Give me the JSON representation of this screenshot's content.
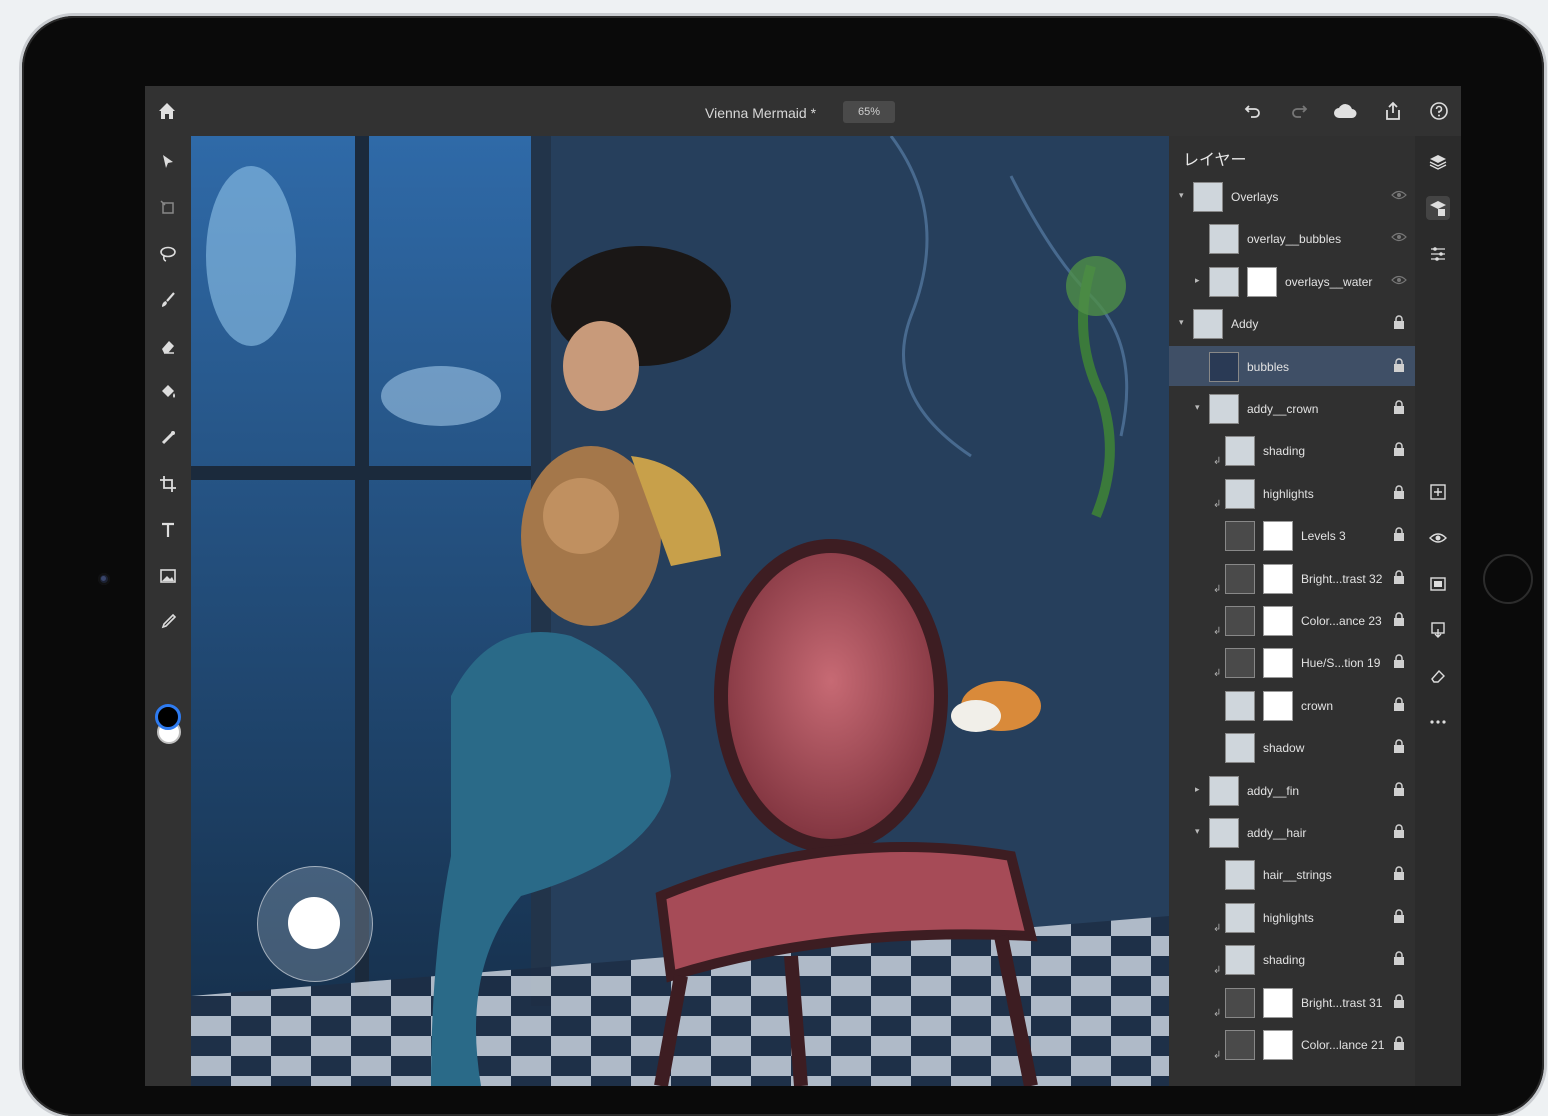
{
  "app": {
    "document_title": "Vienna Mermaid *",
    "zoom": "65%"
  },
  "topbar": {
    "icons": [
      "home-icon",
      "undo-icon",
      "redo-icon",
      "cloud-icon",
      "share-icon",
      "help-icon"
    ]
  },
  "toolbar": {
    "tools": [
      "move-icon",
      "transform-icon",
      "lasso-icon",
      "brush-icon",
      "eraser-icon",
      "paint-bucket-icon",
      "healing-icon",
      "crop-icon",
      "type-icon",
      "place-image-icon",
      "eyedropper-icon"
    ],
    "foreground_color": "#000000",
    "background_color": "#ffffff"
  },
  "layers_panel": {
    "title": "レイヤー",
    "layers": [
      {
        "name": "Overlays",
        "indent": 0,
        "group": true,
        "expanded": true,
        "state": "eye"
      },
      {
        "name": "overlay__bubbles",
        "indent": 1,
        "group": false,
        "state": "eye"
      },
      {
        "name": "overlays__water",
        "indent": 1,
        "group": true,
        "expanded": false,
        "mask": true,
        "state": "eye"
      },
      {
        "name": "Addy",
        "indent": 0,
        "group": true,
        "expanded": true,
        "state": "lock"
      },
      {
        "name": "bubbles",
        "indent": 1,
        "group": false,
        "selected": true,
        "state": "lock"
      },
      {
        "name": "addy__crown",
        "indent": 1,
        "group": true,
        "expanded": true,
        "state": "lock"
      },
      {
        "name": "shading",
        "indent": 2,
        "group": false,
        "clip": true,
        "state": "lock"
      },
      {
        "name": "highlights",
        "indent": 2,
        "group": false,
        "clip": true,
        "state": "lock"
      },
      {
        "name": "Levels 3",
        "indent": 2,
        "group": false,
        "mask": true,
        "adjust": true,
        "state": "lock"
      },
      {
        "name": "Bright...trast 32",
        "indent": 2,
        "group": false,
        "mask": true,
        "adjust": true,
        "clip": true,
        "state": "lock"
      },
      {
        "name": "Color...ance 23",
        "indent": 2,
        "group": false,
        "mask": true,
        "adjust": true,
        "clip": true,
        "state": "lock"
      },
      {
        "name": "Hue/S...tion 19",
        "indent": 2,
        "group": false,
        "mask": true,
        "adjust": true,
        "clip": true,
        "state": "lock"
      },
      {
        "name": "crown",
        "indent": 2,
        "group": false,
        "mask": true,
        "state": "lock"
      },
      {
        "name": "shadow",
        "indent": 2,
        "group": false,
        "state": "lock"
      },
      {
        "name": "addy__fin",
        "indent": 1,
        "group": true,
        "expanded": false,
        "state": "lock"
      },
      {
        "name": "addy__hair",
        "indent": 1,
        "group": true,
        "expanded": true,
        "state": "lock"
      },
      {
        "name": "hair__strings",
        "indent": 2,
        "group": false,
        "state": "lock"
      },
      {
        "name": "highlights",
        "indent": 2,
        "group": false,
        "clip": true,
        "state": "lock"
      },
      {
        "name": "shading",
        "indent": 2,
        "group": false,
        "clip": true,
        "state": "lock"
      },
      {
        "name": "Bright...trast 31",
        "indent": 2,
        "group": false,
        "mask": true,
        "adjust": true,
        "clip": true,
        "state": "lock"
      },
      {
        "name": "Color...lance 21",
        "indent": 2,
        "group": false,
        "mask": true,
        "adjust": true,
        "clip": true,
        "state": "lock"
      }
    ]
  },
  "side_strip": {
    "icons": [
      "layers-icon",
      "layer-properties-icon",
      "adjustments-icon",
      "add-layer-icon",
      "visibility-icon",
      "mask-icon",
      "merge-icon",
      "clear-icon",
      "more-icon"
    ]
  },
  "canvas": {
    "description_icons": [
      "canvas-image"
    ],
    "touch_shortcut": "touch-shortcut-icon"
  }
}
